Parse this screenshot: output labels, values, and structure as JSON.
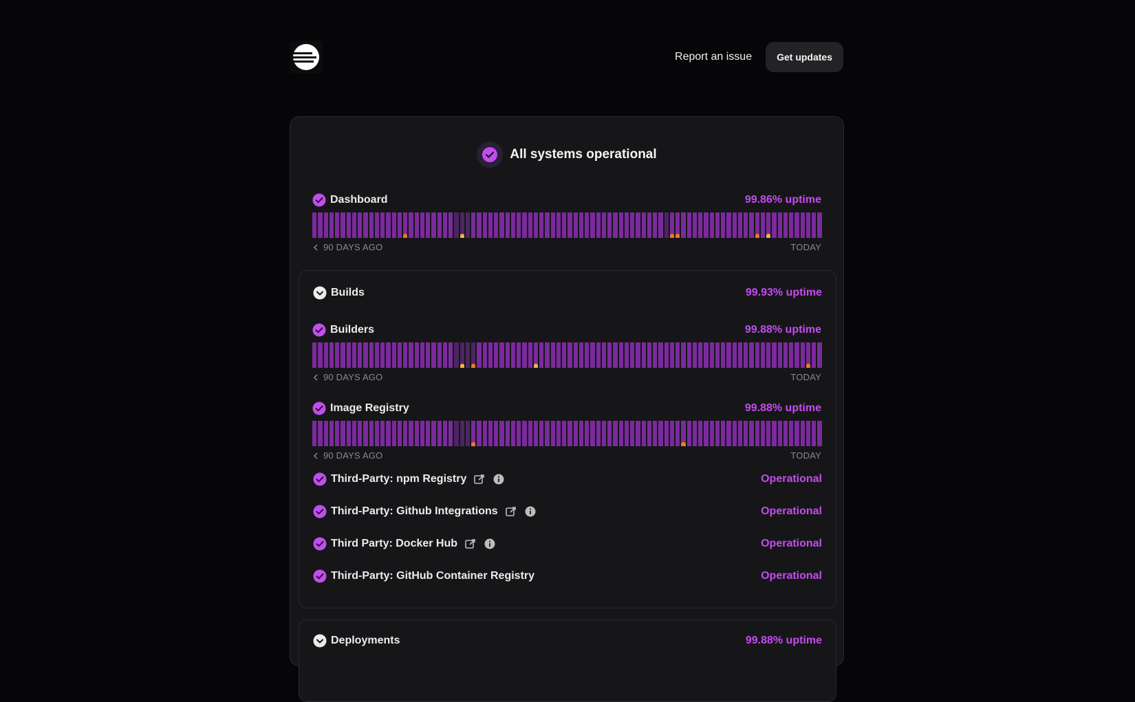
{
  "header": {
    "report_label": "Report an issue",
    "updates_label": "Get updates"
  },
  "banner": {
    "text": "All systems operational"
  },
  "colors": {
    "accent": "#c34cf0",
    "bar": "#7a2a9d",
    "bar_dim": "#4b2660",
    "incident_orange": "#f07a1a",
    "incident_yellow": "#f0b640"
  },
  "timeline": {
    "start_label": "90 DAYS AGO",
    "end_label": "TODAY"
  },
  "dashboard": {
    "name": "Dashboard",
    "uptime": "99.86% uptime",
    "incidents": [
      {
        "day": 18,
        "color": "#f07a1a"
      },
      {
        "day": 29,
        "color": "#f0b640"
      },
      {
        "day": 30,
        "color": "#f0b640"
      },
      {
        "day": 71,
        "color": "#f07a1a"
      },
      {
        "day": 72,
        "color": "#f07a1a"
      },
      {
        "day": 88,
        "color": "#f07a1a"
      },
      {
        "day": 91,
        "color": "#f0b640"
      }
    ],
    "dim_days": [
      28,
      29,
      30,
      31,
      70
    ]
  },
  "builds": {
    "name": "Builds",
    "uptime": "99.93% uptime",
    "builders": {
      "name": "Builders",
      "uptime": "99.88% uptime",
      "incidents": [
        {
          "day": 30,
          "color": "#f0b640"
        },
        {
          "day": 32,
          "color": "#f07a1a"
        },
        {
          "day": 44,
          "color": "#f0b640"
        },
        {
          "day": 99,
          "color": "#f07a1a"
        }
      ],
      "dim_days": [
        28,
        29,
        30,
        31,
        32
      ]
    },
    "image_registry": {
      "name": "Image Registry",
      "uptime": "99.88% uptime",
      "incidents": [
        {
          "day": 32,
          "color": "#f07a1a"
        },
        {
          "day": 74,
          "color": "#f07a1a"
        }
      ],
      "dim_days": [
        28,
        29,
        30,
        31
      ]
    },
    "third_party": [
      {
        "name": "Third-Party: npm Registry",
        "status": "Operational",
        "has_link": true
      },
      {
        "name": "Third-Party: Github Integrations",
        "status": "Operational",
        "has_link": true
      },
      {
        "name": "Third Party: Docker Hub",
        "status": "Operational",
        "has_link": true
      },
      {
        "name": "Third-Party: GitHub Container Registry",
        "status": "Operational",
        "has_link": false
      }
    ]
  },
  "deployments": {
    "name": "Deployments",
    "uptime": "99.88% uptime"
  }
}
